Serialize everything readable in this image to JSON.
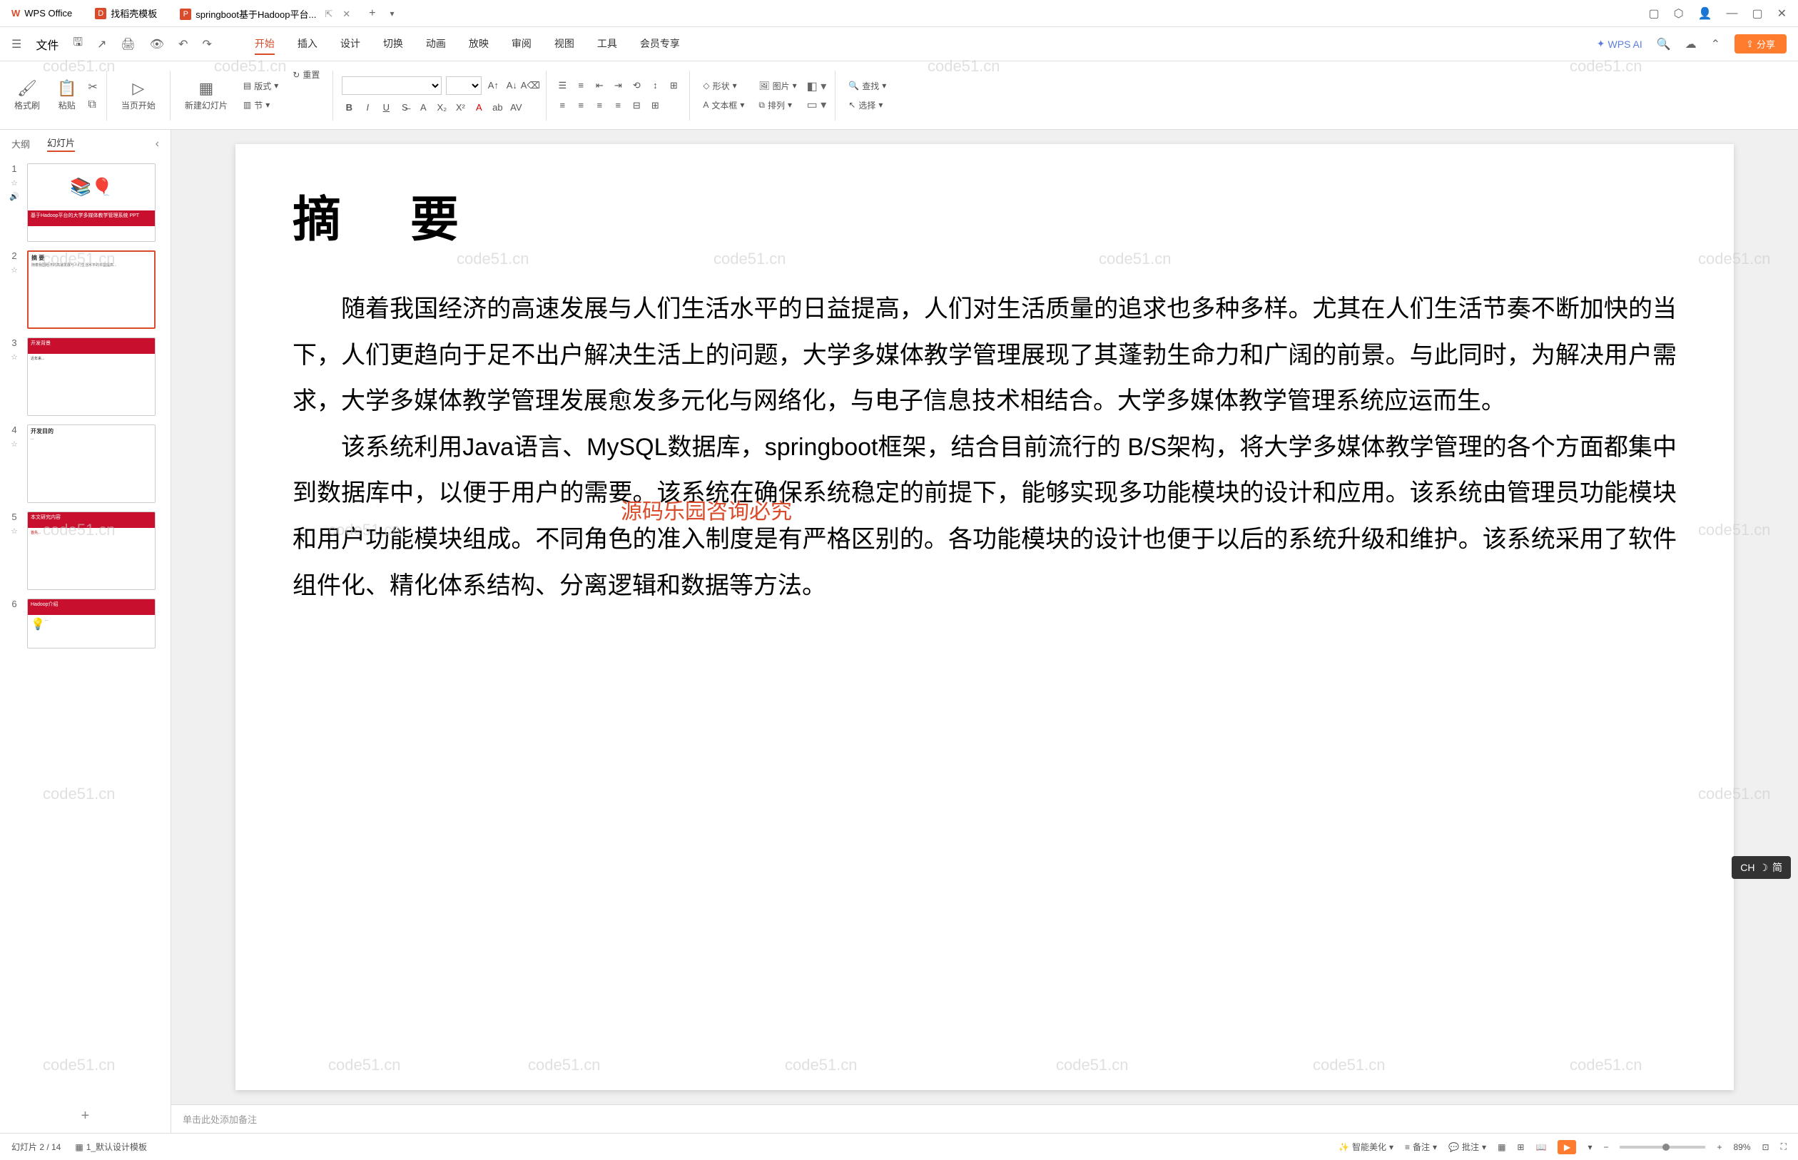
{
  "titlebar": {
    "tabs": [
      {
        "label": "WPS Office",
        "logo": "W"
      },
      {
        "label": "找稻壳模板",
        "logo": "D"
      },
      {
        "label": "springboot基于Hadoop平台...",
        "logo": "P",
        "active": true
      }
    ],
    "add": "+"
  },
  "menubar": {
    "file": "文件",
    "tabs": [
      "开始",
      "插入",
      "设计",
      "切换",
      "动画",
      "放映",
      "审阅",
      "视图",
      "工具",
      "会员专享"
    ],
    "active_tab": "开始",
    "wps_ai": "WPS AI",
    "share": "分享"
  },
  "ribbon": {
    "format_painter": "格式刷",
    "paste": "粘贴",
    "from_current": "当页开始",
    "new_slide": "新建幻灯片",
    "layout": "版式",
    "section": "节",
    "reset": "重置",
    "shape": "形状",
    "picture": "图片",
    "textbox": "文本框",
    "arrange": "排列",
    "find": "查找",
    "select": "选择"
  },
  "left_panel": {
    "tab_outline": "大纲",
    "tab_slides": "幻灯片",
    "slides": [
      {
        "num": "1",
        "title": "基于Hadoop平台的大学多媒体教学管理系统 PPT"
      },
      {
        "num": "2",
        "title": "摘 要",
        "active": true
      },
      {
        "num": "3",
        "title": "开发背景"
      },
      {
        "num": "4",
        "title": "开发目的"
      },
      {
        "num": "5",
        "title": "本文研究内容"
      },
      {
        "num": "6",
        "title": "Hadoop介绍"
      }
    ],
    "add": "+"
  },
  "slide": {
    "title": "摘  要",
    "para1": "随着我国经济的高速发展与人们生活水平的日益提高，人们对生活质量的追求也多种多样。尤其在人们生活节奏不断加快的当下，人们更趋向于足不出户解决生活上的问题，大学多媒体教学管理展现了其蓬勃生命力和广阔的前景。与此同时，为解决用户需求，大学多媒体教学管理发展愈发多元化与网络化，与电子信息技术相结合。大学多媒体教学管理系统应运而生。",
    "para2": "该系统利用Java语言、MySQL数据库，springboot框架，结合目前流行的 B/S架构，将大学多媒体教学管理的各个方面都集中到数据库中，以便于用户的需要。该系统在确保系统稳定的前提下，能够实现多功能模块的设计和应用。该系统由管理员功能模块和用户功能模块组成。不同角色的准入制度是有严格区别的。各功能模块的设计也便于以后的系统升级和维护。该系统采用了软件组件化、精化体系结构、分离逻辑和数据等方法。",
    "watermark_center": "源码乐园咨询必究"
  },
  "notes": {
    "placeholder": "单击此处添加备注"
  },
  "statusbar": {
    "slide_count": "幻灯片 2 / 14",
    "template": "1_默认设计模板",
    "beautify": "智能美化",
    "notes": "备注",
    "comments": "批注",
    "zoom": "89%"
  },
  "ime": {
    "label": "CH",
    "mode": "简"
  },
  "watermark_text": "code51.cn"
}
